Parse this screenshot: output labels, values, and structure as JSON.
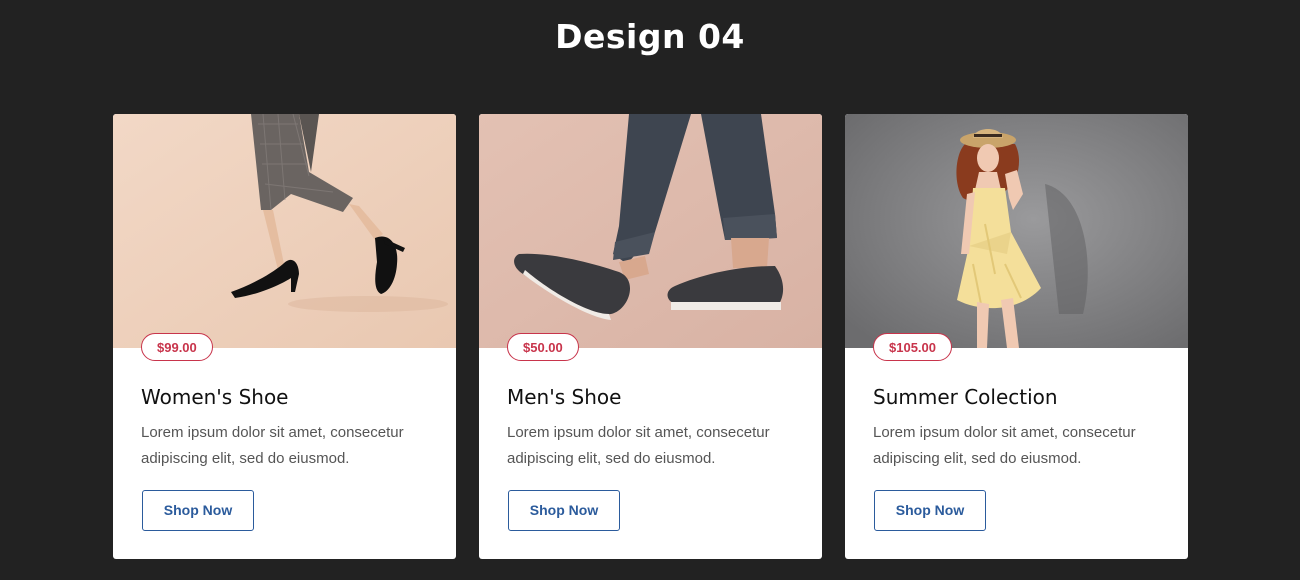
{
  "page": {
    "title": "Design 04"
  },
  "colors": {
    "background": "#222222",
    "card": "#ffffff",
    "price_accent": "#c8344b",
    "button_accent": "#2b5b9c"
  },
  "cards": [
    {
      "price": "$99.00",
      "title": "Women's Shoe",
      "description": "Lorem ipsum dolor sit amet, consecetur adipiscing elit, sed do eiusmod.",
      "button_label": "Shop Now",
      "image_icon": "womens-heels-photo"
    },
    {
      "price": "$50.00",
      "title": "Men's Shoe",
      "description": "Lorem ipsum dolor sit amet, consecetur adipiscing elit, sed do eiusmod.",
      "button_label": "Shop Now",
      "image_icon": "mens-loafers-photo"
    },
    {
      "price": "$105.00",
      "title": "Summer Colection",
      "description": "Lorem ipsum dolor sit amet, consecetur adipiscing elit, sed do eiusmod.",
      "button_label": "Shop Now",
      "image_icon": "summer-dress-photo"
    }
  ]
}
